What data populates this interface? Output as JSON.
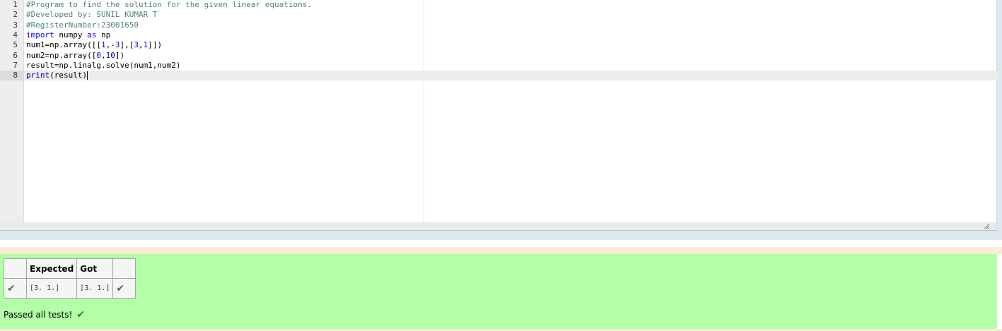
{
  "editor": {
    "line_numbers": [
      "1",
      "2",
      "3",
      "4",
      "5",
      "6",
      "7",
      "8"
    ],
    "lines": [
      [
        {
          "t": "#Program to find the solution for the given linear equations.",
          "c": "comment"
        }
      ],
      [
        {
          "t": "#Developed by: SUNIL KUMAR T",
          "c": "comment"
        }
      ],
      [
        {
          "t": "#RegisterNumber:23001650",
          "c": "comment"
        }
      ],
      [
        {
          "t": "import",
          "c": "kw"
        },
        {
          "t": " numpy ",
          "c": ""
        },
        {
          "t": "as",
          "c": "kw"
        },
        {
          "t": " np",
          "c": ""
        }
      ],
      [
        {
          "t": "num1=np.array([[",
          "c": ""
        },
        {
          "t": "1",
          "c": "num"
        },
        {
          "t": ",-",
          "c": ""
        },
        {
          "t": "3",
          "c": "num"
        },
        {
          "t": "],[",
          "c": ""
        },
        {
          "t": "3",
          "c": "num"
        },
        {
          "t": ",",
          "c": ""
        },
        {
          "t": "1",
          "c": "num"
        },
        {
          "t": "]])",
          "c": ""
        }
      ],
      [
        {
          "t": "num2=np.array([",
          "c": ""
        },
        {
          "t": "0",
          "c": "num"
        },
        {
          "t": ",",
          "c": ""
        },
        {
          "t": "10",
          "c": "num"
        },
        {
          "t": "])",
          "c": ""
        }
      ],
      [
        {
          "t": "result=np.linalg.solve(num1,num2)",
          "c": ""
        }
      ],
      [
        {
          "t": "print",
          "c": "fn"
        },
        {
          "t": "(result)",
          "c": ""
        }
      ]
    ],
    "active_line": 8
  },
  "results": {
    "headers": [
      "",
      "Expected",
      "Got",
      ""
    ],
    "rows": [
      {
        "expected": "[3. 1.]",
        "got": "[3. 1.]",
        "pass_icon": "checkmark-icon",
        "status_icon": "checkmark-icon"
      }
    ],
    "summary": "Passed all tests!"
  },
  "colors": {
    "pass_background": "#b3ffa8",
    "separator": "#faebd7",
    "check": "#3a7a2a"
  }
}
